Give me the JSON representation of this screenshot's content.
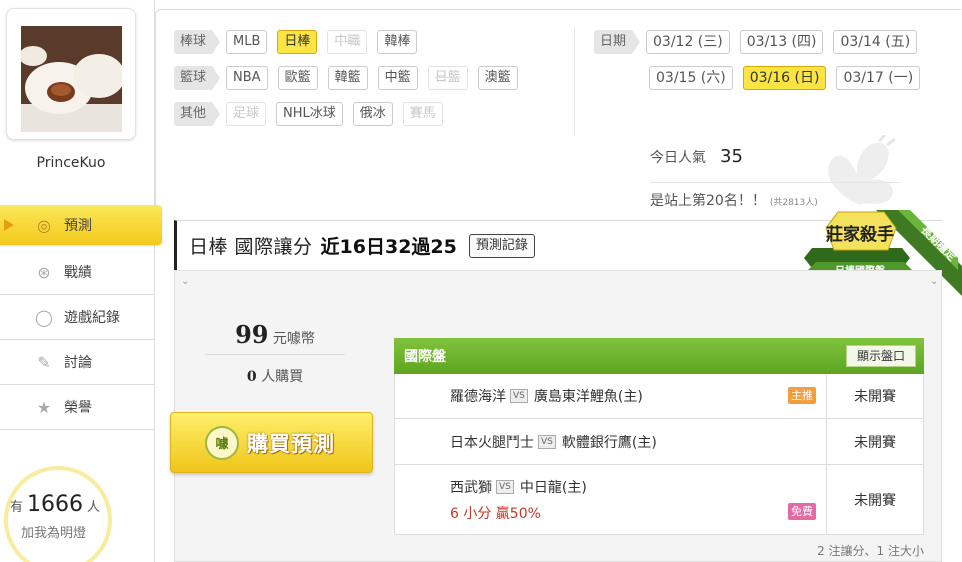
{
  "user": {
    "name": "PrinceKuo"
  },
  "nav": [
    {
      "label": "預測",
      "icon": "target-icon",
      "glyph": "◎",
      "active": true
    },
    {
      "label": "戰績",
      "icon": "chart-badge-icon",
      "glyph": "⊛",
      "active": false
    },
    {
      "label": "遊戲紀錄",
      "icon": "ring-icon",
      "glyph": "◯",
      "active": false
    },
    {
      "label": "討論",
      "icon": "chat-pen-icon",
      "glyph": "✎",
      "active": false
    },
    {
      "label": "榮譽",
      "icon": "medal-icon",
      "glyph": "★",
      "active": false
    }
  ],
  "fans": {
    "prefix": "有",
    "count": "1666",
    "unit": "人",
    "action": "加我為明燈"
  },
  "filters": {
    "baseball": {
      "label": "棒球",
      "tags": [
        {
          "text": "MLB",
          "state": "normal"
        },
        {
          "text": "日棒",
          "state": "active"
        },
        {
          "text": "中職",
          "state": "disabled"
        },
        {
          "text": "韓棒",
          "state": "normal"
        }
      ]
    },
    "basketball": {
      "label": "籃球",
      "tags": [
        {
          "text": "NBA",
          "state": "normal"
        },
        {
          "text": "歐籃",
          "state": "normal"
        },
        {
          "text": "韓籃",
          "state": "normal"
        },
        {
          "text": "中籃",
          "state": "normal"
        },
        {
          "text": "日籃",
          "state": "disabled"
        },
        {
          "text": "澳籃",
          "state": "normal"
        }
      ]
    },
    "other": {
      "label": "其他",
      "tags": [
        {
          "text": "足球",
          "state": "disabled"
        },
        {
          "text": "NHL冰球",
          "state": "normal"
        },
        {
          "text": "俄冰",
          "state": "normal"
        },
        {
          "text": "賽馬",
          "state": "disabled"
        }
      ]
    }
  },
  "dates": {
    "label": "日期",
    "row1": [
      {
        "text": "03/12 (三)",
        "state": "normal"
      },
      {
        "text": "03/13 (四)",
        "state": "normal"
      },
      {
        "text": "03/14 (五)",
        "state": "normal"
      }
    ],
    "row2": [
      {
        "text": "03/15 (六)",
        "state": "normal"
      },
      {
        "text": "03/16 (日)",
        "state": "active"
      },
      {
        "text": "03/17 (一)",
        "state": "normal"
      }
    ]
  },
  "popularity": {
    "label": "今日人氣",
    "value": "35"
  },
  "rank": {
    "text": "是站上第20名！！",
    "total": "(共2813人)"
  },
  "main": {
    "title": "日棒 國際讓分",
    "stat": "近16日32過25",
    "record_button": "預測記錄",
    "price": "99",
    "price_unit": "元噱幣",
    "buyers_count": "0",
    "buyers_unit": "人購買",
    "buy_badge": "噱",
    "buy_label": "購買預測",
    "emblem_title": "莊家殺手",
    "emblem_sub": "日棒國際盤",
    "emblem_ribbon": "長期穩定"
  },
  "games": {
    "header": "國際盤",
    "show_button": "顯示盤口",
    "vs": "VS",
    "rows": [
      {
        "away": "羅德海洋",
        "home": "廣島東洋鯉魚(主)",
        "badge": "主推",
        "badge_type": "main",
        "status": "未開賽",
        "prediction": ""
      },
      {
        "away": "日本火腿鬥士",
        "home": "軟體銀行鷹(主)",
        "badge": "",
        "badge_type": "",
        "status": "未開賽",
        "prediction": ""
      },
      {
        "away": "西武獅",
        "home": "中日龍(主)",
        "badge": "免費",
        "badge_type": "free",
        "status": "未開賽",
        "prediction": "6 小分  贏50%"
      }
    ],
    "summary": "2 注讓分、1 注大小"
  },
  "colors": {
    "accent_yellow": "#fde445",
    "green_header": "#6cb22c",
    "main_badge": "#f19e3b",
    "free_badge": "#e46aa6",
    "prediction_red": "#c0392b"
  }
}
